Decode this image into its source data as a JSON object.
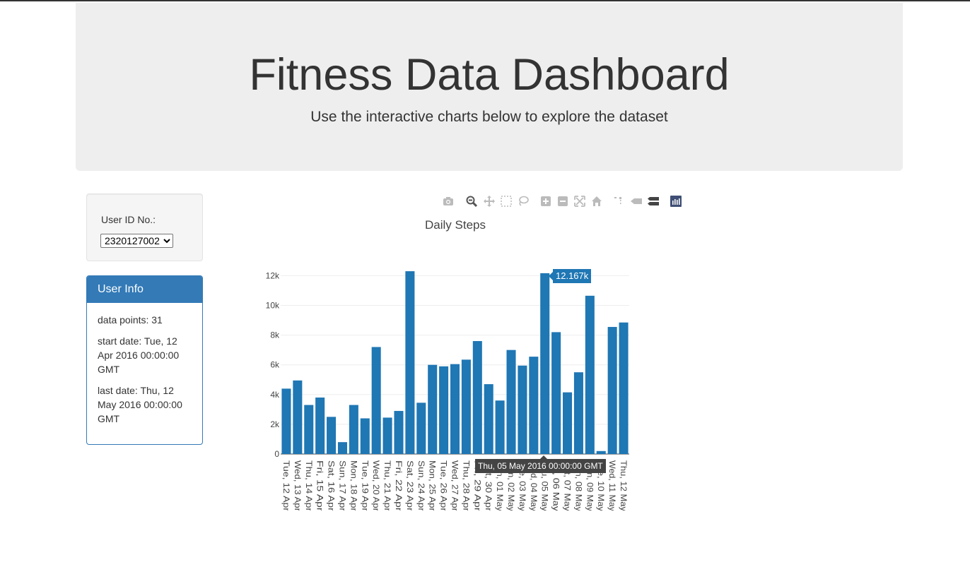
{
  "header": {
    "title": "Fitness Data Dashboard",
    "subtitle": "Use the interactive charts below to explore the dataset"
  },
  "user_select": {
    "label": "User ID No.:",
    "selected": "2320127002"
  },
  "user_info": {
    "heading": "User Info",
    "data_points": "data points: 31",
    "start_date": "start date: Tue, 12 Apr 2016 00:00:00 GMT",
    "last_date": "last date: Thu, 12 May 2016 00:00:00 GMT"
  },
  "modebar": {
    "icons": [
      "camera-icon",
      "zoom-icon",
      "pan-icon",
      "box-select-icon",
      "lasso-select-icon",
      "zoom-in-icon",
      "zoom-out-icon",
      "autoscale-icon",
      "reset-axes-icon",
      "spike-lines-icon",
      "hover-closest-icon",
      "hover-compare-icon",
      "plotly-logo-icon"
    ]
  },
  "hover": {
    "x_label": "Thu, 05 May 2016 00:00:00 GMT",
    "y_label": "12.167k"
  },
  "colors": {
    "bar": "#1f77b4",
    "panel": "#337ab7",
    "jumbotron": "#eeeeee"
  },
  "chart_data": {
    "type": "bar",
    "title": "Daily Steps",
    "xlabel": "",
    "ylabel": "",
    "ylim": [
      0,
      12400
    ],
    "yticks": [
      0,
      2000,
      4000,
      6000,
      8000,
      10000,
      12000
    ],
    "ytick_labels": [
      "0",
      "2k",
      "4k",
      "6k",
      "8k",
      "10k",
      "12k"
    ],
    "grid": true,
    "categories": [
      "Tue, 12 Apr",
      "Wed, 13 Apr",
      "Thu, 14 Apr",
      "Fri, 15 Apr",
      "Sat, 16 Apr",
      "Sun, 17 Apr",
      "Mon, 18 Apr",
      "Tue, 19 Apr",
      "Wed, 20 Apr",
      "Thu, 21 Apr",
      "Fri, 22 Apr",
      "Sat, 23 Apr",
      "Sun, 24 Apr",
      "Mon, 25 Apr",
      "Tue, 26 Apr",
      "Wed, 27 Apr",
      "Thu, 28 Apr",
      "Fri, 29 Apr",
      "Sat, 30 Apr",
      "Sun, 01 May",
      "Mon, 02 May",
      "Tue, 03 May",
      "Wed, 04 May",
      "Thu, 05 May",
      "Fri, 06 May",
      "Sat, 07 May",
      "Sun, 08 May",
      "Mon, 09 May",
      "Tue, 10 May",
      "Wed, 11 May",
      "Thu, 12 May"
    ],
    "values": [
      4400,
      4950,
      3300,
      3800,
      2500,
      800,
      3300,
      2400,
      7200,
      2450,
      2900,
      12300,
      3450,
      6000,
      5900,
      6050,
      6350,
      7600,
      4700,
      3600,
      7000,
      5950,
      6550,
      12167,
      8200,
      4150,
      5500,
      10650,
      200,
      8550,
      8850
    ]
  }
}
